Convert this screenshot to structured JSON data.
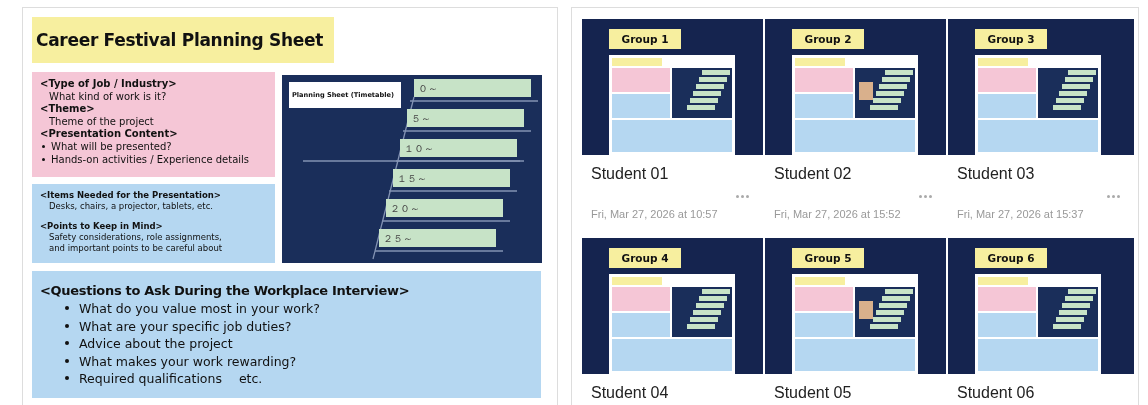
{
  "slide": {
    "title": "Career Festival Planning Sheet",
    "profile_box": [
      {
        "kind": "heading",
        "text": "<Type of Job / Industry>"
      },
      {
        "kind": "text",
        "text": "What kind of work is it?"
      },
      {
        "kind": "heading",
        "text": "<Theme>"
      },
      {
        "kind": "text",
        "text": "Theme of the project"
      },
      {
        "kind": "heading",
        "text": "<Presentation Content>"
      },
      {
        "kind": "bullet",
        "text": "What will be presented?"
      },
      {
        "kind": "bullet",
        "text": "Hands-on activities / Experience details"
      }
    ],
    "materials_box": [
      {
        "kind": "heading",
        "text": "<Items Needed for the Presentation>"
      },
      {
        "kind": "text",
        "text": "Desks, chairs, a projector, tablets, etc."
      },
      {
        "kind": "heading",
        "text": "<Points to Keep in Mind>"
      },
      {
        "kind": "text",
        "text": "Safety considerations, role assignments,"
      },
      {
        "kind": "text",
        "text": "and important points to be careful about"
      }
    ],
    "timetable": {
      "title": "Planning Sheet (Timetable)",
      "slots": [
        "０～",
        "５～",
        "１０～",
        "１５～",
        "２０～",
        "２５～"
      ]
    },
    "questions": {
      "heading": "<Questions to Ask During the Workplace Interview>",
      "items": [
        "What do you value most in your work?",
        "What are your specific job duties?",
        "Advice about the project",
        "What makes your work rewarding?",
        "Required qualifications　 etc."
      ]
    }
  },
  "gallery": {
    "cards": [
      {
        "group": "Group 1",
        "name": "Student 01",
        "date": "Fri, Mar 27, 2026 at 10:57",
        "has_photo": false
      },
      {
        "group": "Group 2",
        "name": "Student 02",
        "date": "Fri, Mar 27, 2026 at 15:52",
        "has_photo": true
      },
      {
        "group": "Group 3",
        "name": "Student 03",
        "date": "Fri, Mar 27, 2026 at 15:37",
        "has_photo": false
      },
      {
        "group": "Group 4",
        "name": "Student 04",
        "has_photo": false
      },
      {
        "group": "Group 5",
        "name": "Student 05",
        "has_photo": true
      },
      {
        "group": "Group 6",
        "name": "Student 06",
        "has_photo": false
      }
    ]
  }
}
